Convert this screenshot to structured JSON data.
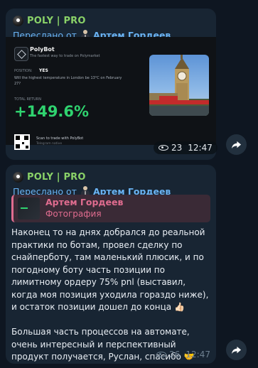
{
  "messages": [
    {
      "channel": "POLY | PRO",
      "forwarded_prefix": "Переслано от",
      "forwarded_from": "Артем Гордеев",
      "card": {
        "brand": "PolyBot",
        "tagline": "The fastest way to trade on Polymarket",
        "position_label": "POSITION:",
        "position_value": "YES",
        "question": "Will the highest temperature in London be 13°C on February 27?",
        "total_return_label": "TOTAL RETURN",
        "total_return_value": "+149.6%",
        "scan_text": "Scan to trade with PolyBot",
        "scan_sub": "Telegram native"
      },
      "views": "23",
      "time": "12:47"
    },
    {
      "channel": "POLY | PRO",
      "forwarded_prefix": "Переслано от",
      "forwarded_from": "Артем Гордеев",
      "reply_name": "Артем Гордеев",
      "reply_type": "Фотография",
      "text": "Наконец то на днях добрался до реальной практики по ботам, провел сделку по снайперботу, там маленький плюсик, и по погодному боту часть позиции по лимитному ордеру 75% pnl (выставил, когда моя позиция уходила гораздо ниже), и остаток позиции дошел до конца 👍🏻\n\nБольшая часть процессов на автомате, очень интересный и перспективный продукт получается, Руслан, спасибо 🤝",
      "views": "26",
      "time": "12:47"
    }
  ],
  "colors": {
    "background": "#0e1621",
    "bubble": "#182533",
    "channel_name": "#8ad268",
    "forward_link": "#6ab3f3",
    "reply_accent": "#e06c8f",
    "return_green": "#2fd36f"
  },
  "icons": [
    "channel-avatar-icon",
    "person-icon",
    "eye-icon",
    "share-icon",
    "polybot-logo-icon",
    "qr-code-icon"
  ]
}
